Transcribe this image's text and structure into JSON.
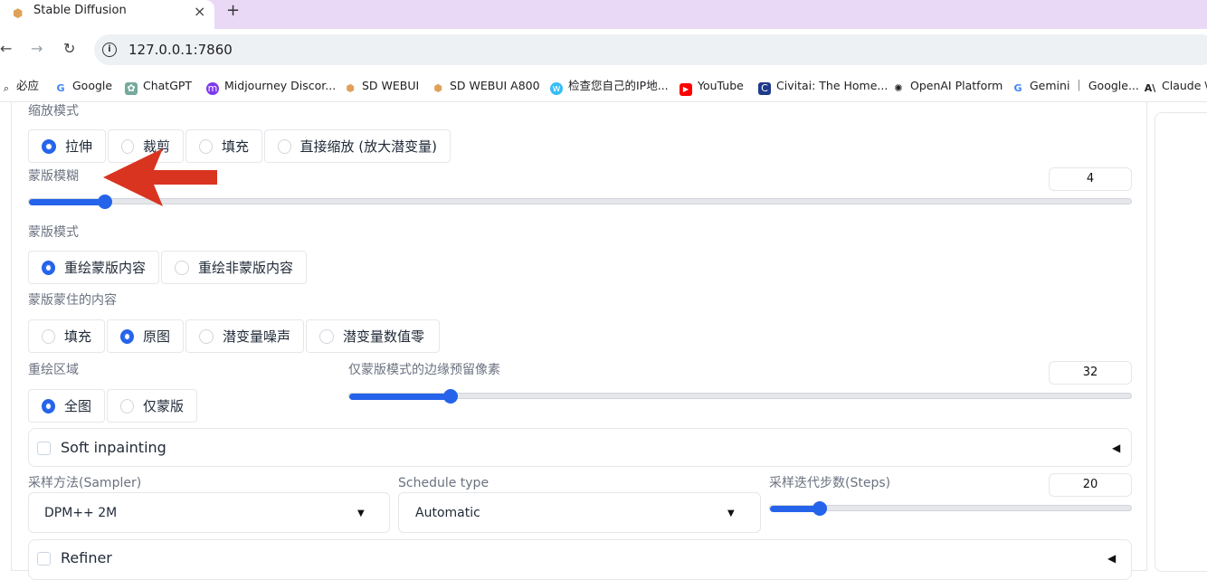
{
  "browser": {
    "tab_title": "Stable Diffusion",
    "url": "127.0.0.1:7860",
    "bookmarks": [
      {
        "label": "必应",
        "icon": "search-icon"
      },
      {
        "label": "Google",
        "icon": "google-icon"
      },
      {
        "label": "ChatGPT",
        "icon": "chatgpt-icon"
      },
      {
        "label": "Midjourney Discor...",
        "icon": "midjourney-icon"
      },
      {
        "label": "SD WEBUI",
        "icon": "sd-icon"
      },
      {
        "label": "SD WEBUI A800",
        "icon": "sd-icon"
      },
      {
        "label": "检查您自己的IP地...",
        "icon": "ip-check-icon"
      },
      {
        "label": "YouTube",
        "icon": "youtube-icon"
      },
      {
        "label": "Civitai: The Home...",
        "icon": "civitai-icon"
      },
      {
        "label": "OpenAI Platform",
        "icon": "openai-icon"
      },
      {
        "label": "Gemini ｜ Google...",
        "icon": "google-icon"
      },
      {
        "label": "Claude \\",
        "icon": "anthropic-icon"
      }
    ]
  },
  "resize_mode": {
    "label": "缩放模式",
    "options": [
      "拉伸",
      "裁剪",
      "填充",
      "直接缩放 (放大潜变量)"
    ],
    "selected": 0
  },
  "mask_blur": {
    "label": "蒙版模糊",
    "value": "4",
    "fraction": 0.07
  },
  "mask_mode": {
    "label": "蒙版模式",
    "options": [
      "重绘蒙版内容",
      "重绘非蒙版内容"
    ],
    "selected": 0
  },
  "masked_content": {
    "label": "蒙版蒙住的内容",
    "options": [
      "填充",
      "原图",
      "潜变量噪声",
      "潜变量数值零"
    ],
    "selected": 1
  },
  "inpaint_area": {
    "label": "重绘区域",
    "options": [
      "全图",
      "仅蒙版"
    ],
    "selected": 0
  },
  "only_masked_padding": {
    "label": "仅蒙版模式的边缘预留像素",
    "value": "32",
    "fraction": 0.13
  },
  "soft_inpainting": {
    "label": "Soft inpainting"
  },
  "sampler": {
    "label": "采样方法(Sampler)",
    "value": "DPM++ 2M"
  },
  "schedule_type": {
    "label": "Schedule type",
    "value": "Automatic"
  },
  "steps": {
    "label": "采样迭代步数(Steps)",
    "value": "20",
    "fraction": 0.14
  },
  "refiner": {
    "label": "Refiner"
  },
  "colors": {
    "accent": "#2563eb",
    "annotation_arrow": "#d9341f"
  }
}
